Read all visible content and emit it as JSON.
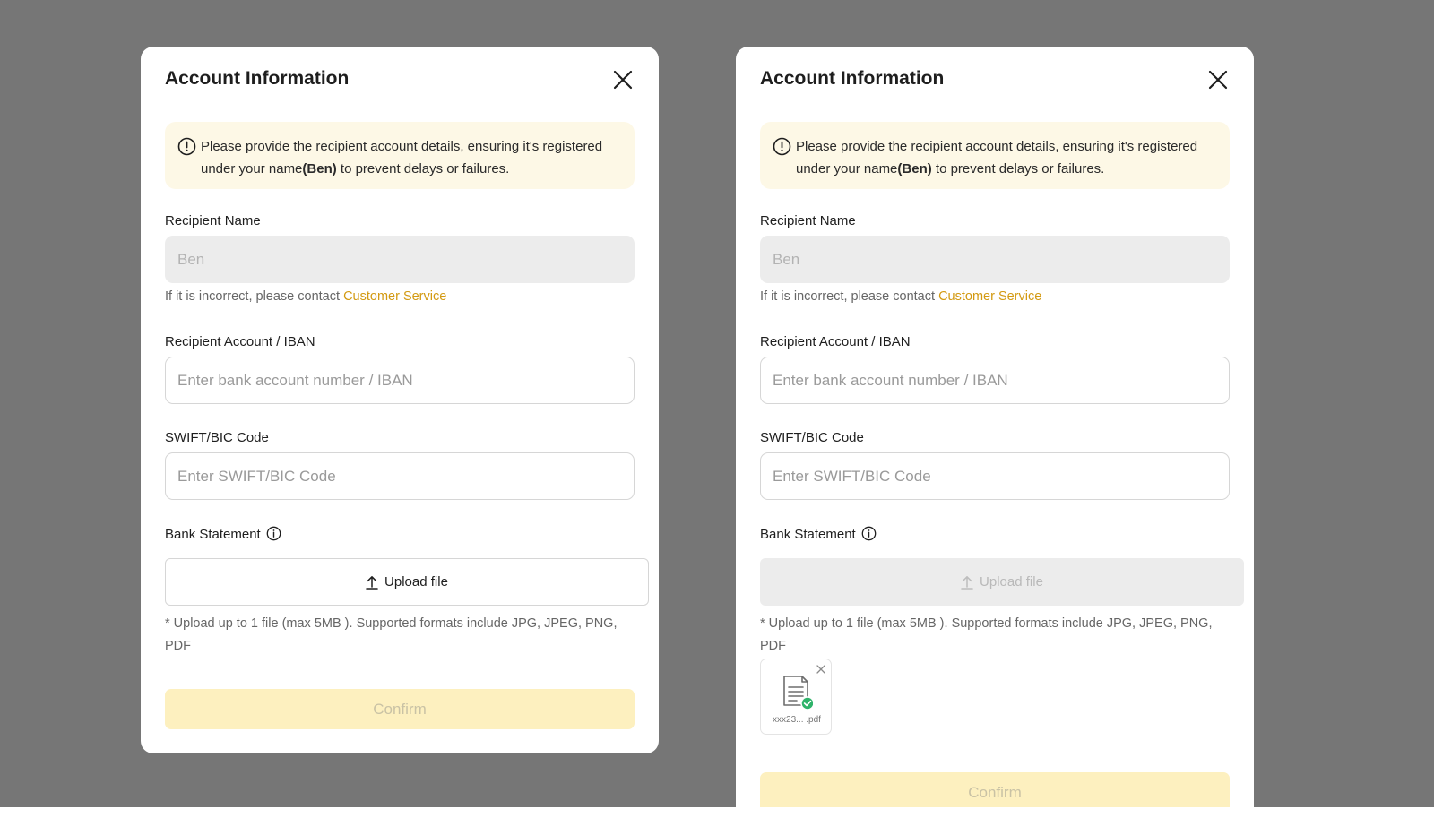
{
  "colors": {
    "overlay": "#767676",
    "accent_link": "#d39a12",
    "notice_bg": "#fdf8e6",
    "confirm_bg": "#fdf0bf",
    "success": "#2fb36a"
  },
  "modals": [
    {
      "title": "Account Information",
      "notice": {
        "prefix": "Please provide the recipient account details, ensuring it's registered under your name",
        "name": "(Ben)",
        "suffix": " to prevent delays or failures."
      },
      "recipient_name": {
        "label": "Recipient Name",
        "value": "Ben"
      },
      "name_hint": {
        "text": "If it is incorrect, please contact ",
        "link": "Customer Service"
      },
      "account": {
        "label": "Recipient Account / IBAN",
        "placeholder": "Enter bank account number / IBAN"
      },
      "swift": {
        "label": "SWIFT/BIC Code",
        "placeholder": "Enter SWIFT/BIC Code"
      },
      "statement": {
        "label": "Bank Statement",
        "upload_label": "Upload file",
        "upload_disabled": false
      },
      "formats": "* Upload up to 1 file (max 5MB ). Supported formats include JPG, JPEG, PNG, PDF",
      "confirm_label": "Confirm"
    },
    {
      "title": "Account Information",
      "notice": {
        "prefix": "Please provide the recipient account details, ensuring it's registered under your name",
        "name": "(Ben)",
        "suffix": " to prevent delays or failures."
      },
      "recipient_name": {
        "label": "Recipient Name",
        "value": "Ben"
      },
      "name_hint": {
        "text": "If it is incorrect, please contact ",
        "link": "Customer Service"
      },
      "account": {
        "label": "Recipient Account / IBAN",
        "placeholder": "Enter bank account number / IBAN"
      },
      "swift": {
        "label": "SWIFT/BIC Code",
        "placeholder": "Enter SWIFT/BIC Code"
      },
      "statement": {
        "label": "Bank Statement",
        "upload_label": "Upload file",
        "upload_disabled": true
      },
      "formats": "* Upload up to 1 file (max 5MB ). Supported formats include JPG, JPEG, PNG, PDF",
      "uploaded_file": {
        "name": "xxx23... .pdf",
        "icon": "document-check-icon"
      },
      "confirm_label": "Confirm"
    }
  ]
}
